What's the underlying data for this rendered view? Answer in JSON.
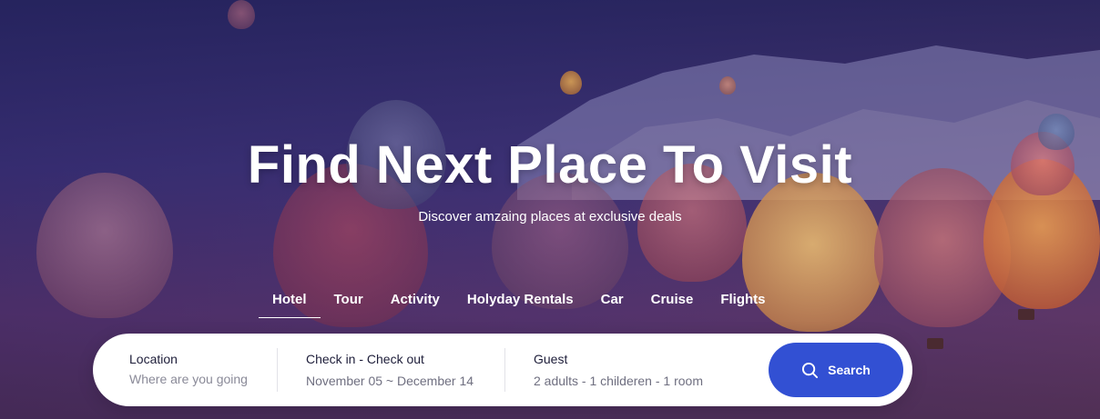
{
  "hero": {
    "title": "Find Next Place To Visit",
    "subtitle": "Discover amzaing places at exclusive deals"
  },
  "tabs": [
    {
      "label": "Hotel",
      "active": true
    },
    {
      "label": "Tour"
    },
    {
      "label": "Activity"
    },
    {
      "label": "Holyday Rentals"
    },
    {
      "label": "Car"
    },
    {
      "label": "Cruise"
    },
    {
      "label": "Flights"
    }
  ],
  "search": {
    "location_label": "Location",
    "location_placeholder": "Where are you going?",
    "dates_label": "Check in - Check out",
    "dates_value": "November 05 ~ December 14",
    "guest_label": "Guest",
    "guest_value": "2 adults - 1 childeren - 1 room",
    "button_label": "Search",
    "button_icon": "search-icon"
  },
  "colors": {
    "accent": "#3250d3",
    "overlay": "#2a2a6a"
  }
}
